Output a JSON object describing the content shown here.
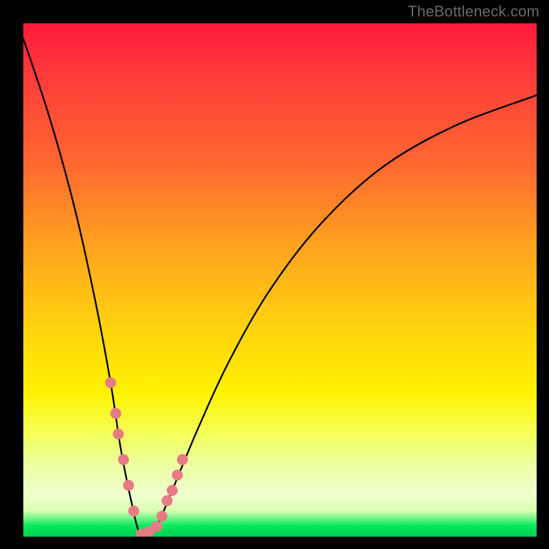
{
  "watermark": "TheBottleneck.com",
  "chart_data": {
    "type": "line",
    "title": "",
    "xlabel": "",
    "ylabel": "",
    "xlim": [
      0,
      100
    ],
    "ylim": [
      0,
      100
    ],
    "background_gradient": {
      "top": "#ff1a3c",
      "middle": "#fff200",
      "bottom": "#00d050"
    },
    "series": [
      {
        "name": "bottleneck-curve",
        "color": "#000000",
        "x": [
          0,
          5,
          10,
          14,
          17,
          19,
          21,
          22.5,
          24,
          26,
          29,
          34,
          40,
          48,
          58,
          70,
          84,
          100
        ],
        "values": [
          97,
          82,
          64,
          46,
          30,
          17,
          7,
          1,
          0,
          2,
          9,
          21,
          34,
          48,
          61,
          72,
          80,
          86
        ]
      }
    ],
    "markers": {
      "name": "highlighted-points",
      "color": "#e77b84",
      "radius": 8,
      "x": [
        17,
        18,
        18.5,
        19.5,
        20.5,
        21.5,
        23,
        24.5,
        26,
        27,
        28,
        29,
        30,
        31
      ],
      "values": [
        30,
        24,
        20,
        15,
        10,
        5,
        0.5,
        1,
        2,
        4,
        7,
        9,
        12,
        15
      ]
    }
  }
}
